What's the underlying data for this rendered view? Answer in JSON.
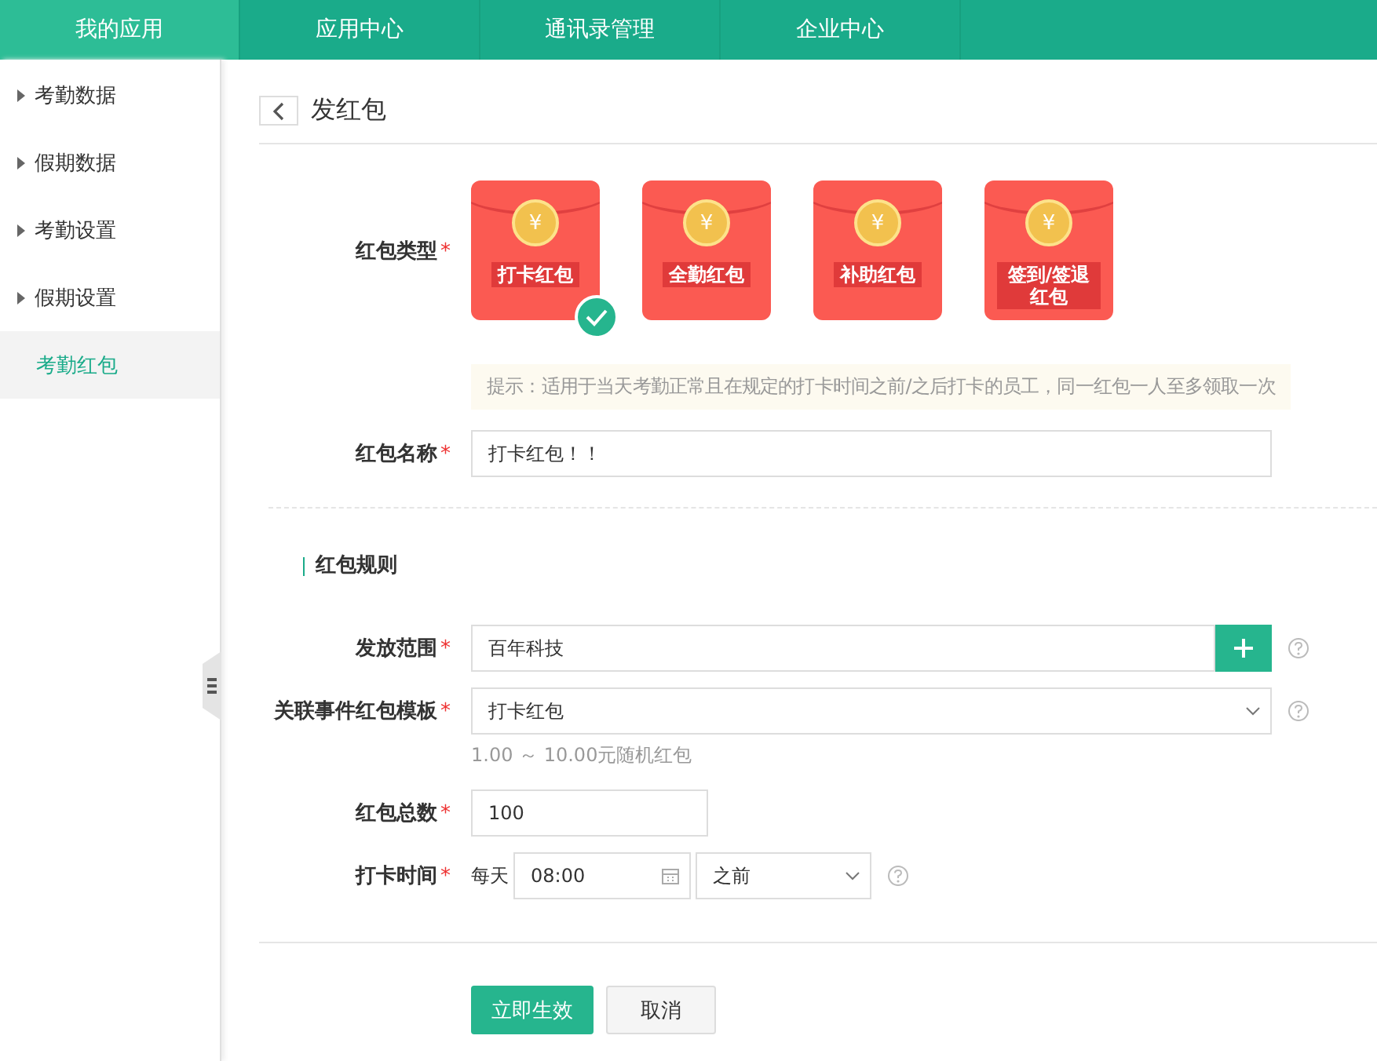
{
  "top_nav": [
    {
      "label": "我的应用",
      "selected": true
    },
    {
      "label": "应用中心",
      "selected": false
    },
    {
      "label": "通讯录管理",
      "selected": false
    },
    {
      "label": "企业中心",
      "selected": false
    }
  ],
  "sidebar": {
    "items": [
      {
        "label": "考勤数据",
        "selected": false
      },
      {
        "label": "假期数据",
        "selected": false
      },
      {
        "label": "考勤设置",
        "selected": false
      },
      {
        "label": "假期设置",
        "selected": false
      },
      {
        "label": "考勤红包",
        "selected": true
      }
    ]
  },
  "page": {
    "title": "发红包"
  },
  "form": {
    "type_label": "红包类型",
    "types": [
      {
        "label": "打卡红包",
        "selected": true
      },
      {
        "label": "全勤红包",
        "selected": false
      },
      {
        "label": "补助红包",
        "selected": false
      },
      {
        "label": "签到/签退红包",
        "selected": false
      }
    ],
    "coin_symbol": "¥",
    "required_mark": "*",
    "tip": "提示：适用于当天考勤正常且在规定的打卡时间之前/之后打卡的员工，同一红包一人至多领取一次",
    "name_label": "红包名称",
    "name_value": "打卡红包！！",
    "section_title": "红包规则",
    "scope_label": "发放范围",
    "scope_value": "百年科技",
    "template_label": "关联事件红包模板",
    "template_value": "打卡红包",
    "template_hint": "1.00 ～ 10.00元随机红包",
    "total_label": "红包总数",
    "total_value": "100",
    "time_label": "打卡时间",
    "time_prefix": "每天",
    "time_value": "08:00",
    "time_relation": "之前"
  },
  "buttons": {
    "confirm": "立即生效",
    "cancel": "取消"
  }
}
